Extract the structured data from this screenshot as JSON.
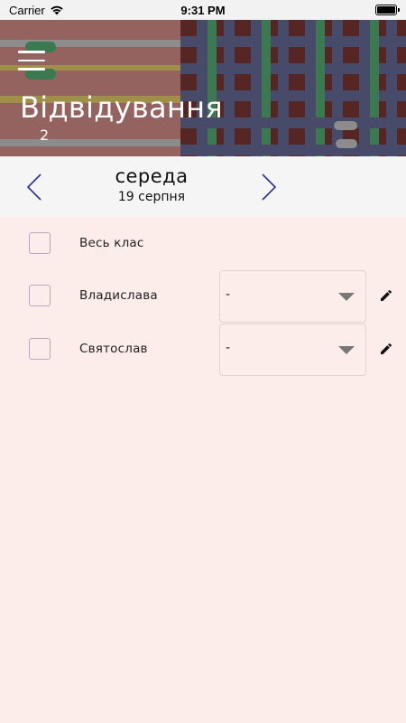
{
  "status_bar": {
    "carrier": "Carrier",
    "time": "9:31 PM"
  },
  "header": {
    "title": "Відвідування",
    "subtitle": "2",
    "icons": {
      "menu": "hamburger-menu-icon"
    }
  },
  "date_nav": {
    "day_name": "середа",
    "date": "19 серпня",
    "icons": {
      "prev": "chevron-left-icon",
      "next": "chevron-right-icon"
    }
  },
  "attendance": {
    "all_class_label": "Весь клас",
    "students": [
      {
        "name": "Владислава",
        "status": "-"
      },
      {
        "name": "Святослав",
        "status": "-"
      }
    ]
  },
  "colors": {
    "background": "#fcecea",
    "date_bar": "#f5f5f5",
    "accent_arrow": "#2b2f8f",
    "header_green": "#3b7a50",
    "header_navy": "#474a68",
    "header_brick": "#946360"
  }
}
